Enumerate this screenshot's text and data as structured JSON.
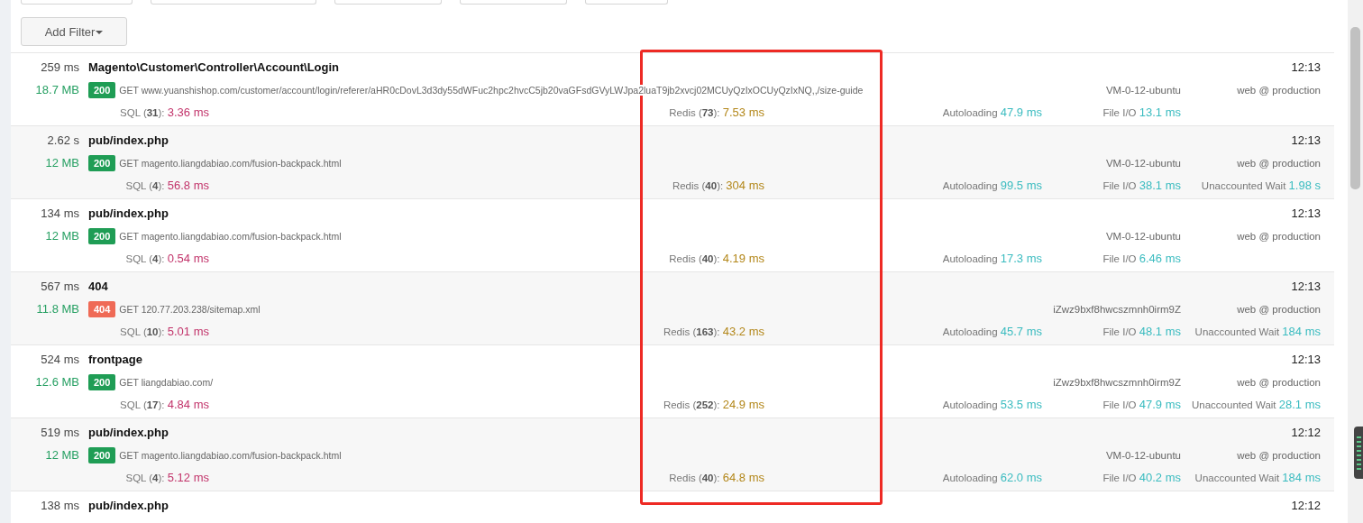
{
  "toolbar": {
    "add_filter": "Add Filter"
  },
  "requests": [
    {
      "duration": "259 ms",
      "name": "Magento\\Customer\\Controller\\Account\\Login",
      "time": "12:13",
      "memory": "18.7 MB",
      "status": {
        "code": "200",
        "kind": "ok"
      },
      "request": "GET www.yuanshishop.com/customer/account/login/referer/aHR0cDovL3d3dy55dWFuc2hpc2hvcC5jb20vaGFsdGVyLWJpa2luaT9jb2xvcj02MCUyQzIxOCUyQzIxNQ,,/size-guide",
      "host": "VM-0-12-ubuntu",
      "env": "web @ production",
      "metrics": [
        {
          "kind": "sql",
          "label": "SQL (**31**):",
          "value": "3.36 ms"
        },
        {
          "kind": "redis",
          "label": "Redis (**73**):",
          "value": "7.53 ms"
        },
        {
          "kind": "autoloading",
          "label": "Autoloading",
          "value": "47.9 ms"
        },
        {
          "kind": "file_io",
          "label": "File I/O",
          "value": "13.1 ms"
        }
      ]
    },
    {
      "duration": "2.62 s",
      "name": "pub/index.php",
      "time": "12:13",
      "memory": "12 MB",
      "status": {
        "code": "200",
        "kind": "ok"
      },
      "request": "GET magento.liangdabiao.com/fusion-backpack.html",
      "host": "VM-0-12-ubuntu",
      "env": "web @ production",
      "metrics": [
        {
          "kind": "sql",
          "label": "SQL (**4**):",
          "value": "56.8 ms"
        },
        {
          "kind": "redis",
          "label": "Redis (**40**):",
          "value": "304 ms"
        },
        {
          "kind": "autoloading",
          "label": "Autoloading",
          "value": "99.5 ms"
        },
        {
          "kind": "file_io",
          "label": "File I/O",
          "value": "38.1 ms"
        },
        {
          "kind": "wait",
          "label": "Unaccounted Wait",
          "value": "1.98 s"
        }
      ]
    },
    {
      "duration": "134 ms",
      "name": "pub/index.php",
      "time": "12:13",
      "memory": "12 MB",
      "status": {
        "code": "200",
        "kind": "ok"
      },
      "request": "GET magento.liangdabiao.com/fusion-backpack.html",
      "host": "VM-0-12-ubuntu",
      "env": "web @ production",
      "metrics": [
        {
          "kind": "sql",
          "label": "SQL (**4**):",
          "value": "0.54 ms"
        },
        {
          "kind": "redis",
          "label": "Redis (**40**):",
          "value": "4.19 ms"
        },
        {
          "kind": "autoloading",
          "label": "Autoloading",
          "value": "17.3 ms"
        },
        {
          "kind": "file_io",
          "label": "File I/O",
          "value": "6.46 ms"
        }
      ]
    },
    {
      "duration": "567 ms",
      "name": "404",
      "time": "12:13",
      "memory": "11.8 MB",
      "status": {
        "code": "404",
        "kind": "error"
      },
      "request": "GET 120.77.203.238/sitemap.xml",
      "host": "iZwz9bxf8hwcszmnh0irm9Z",
      "env": "web @ production",
      "metrics": [
        {
          "kind": "sql",
          "label": "SQL (**10**):",
          "value": "5.01 ms"
        },
        {
          "kind": "redis",
          "label": "Redis (**163**):",
          "value": "43.2 ms"
        },
        {
          "kind": "autoloading",
          "label": "Autoloading",
          "value": "45.7 ms"
        },
        {
          "kind": "file_io",
          "label": "File I/O",
          "value": "48.1 ms"
        },
        {
          "kind": "wait",
          "label": "Unaccounted Wait",
          "value": "184 ms"
        }
      ]
    },
    {
      "duration": "524 ms",
      "name": "frontpage",
      "time": "12:13",
      "memory": "12.6 MB",
      "status": {
        "code": "200",
        "kind": "ok"
      },
      "request": "GET liangdabiao.com/",
      "host": "iZwz9bxf8hwcszmnh0irm9Z",
      "env": "web @ production",
      "metrics": [
        {
          "kind": "sql",
          "label": "SQL (**17**):",
          "value": "4.84 ms"
        },
        {
          "kind": "redis",
          "label": "Redis (**252**):",
          "value": "24.9 ms"
        },
        {
          "kind": "autoloading",
          "label": "Autoloading",
          "value": "53.5 ms"
        },
        {
          "kind": "file_io",
          "label": "File I/O",
          "value": "47.9 ms"
        },
        {
          "kind": "wait",
          "label": "Unaccounted Wait",
          "value": "28.1 ms"
        }
      ]
    },
    {
      "duration": "519 ms",
      "name": "pub/index.php",
      "time": "12:12",
      "memory": "12 MB",
      "status": {
        "code": "200",
        "kind": "ok"
      },
      "request": "GET magento.liangdabiao.com/fusion-backpack.html",
      "host": "VM-0-12-ubuntu",
      "env": "web @ production",
      "metrics": [
        {
          "kind": "sql",
          "label": "SQL (**4**):",
          "value": "5.12 ms"
        },
        {
          "kind": "redis",
          "label": "Redis (**40**):",
          "value": "64.8 ms"
        },
        {
          "kind": "autoloading",
          "label": "Autoloading",
          "value": "62.0 ms"
        },
        {
          "kind": "file_io",
          "label": "File I/O",
          "value": "40.2 ms"
        },
        {
          "kind": "wait",
          "label": "Unaccounted Wait",
          "value": "184 ms"
        }
      ]
    },
    {
      "duration": "138 ms",
      "name": "pub/index.php",
      "time": "12:12"
    }
  ]
}
